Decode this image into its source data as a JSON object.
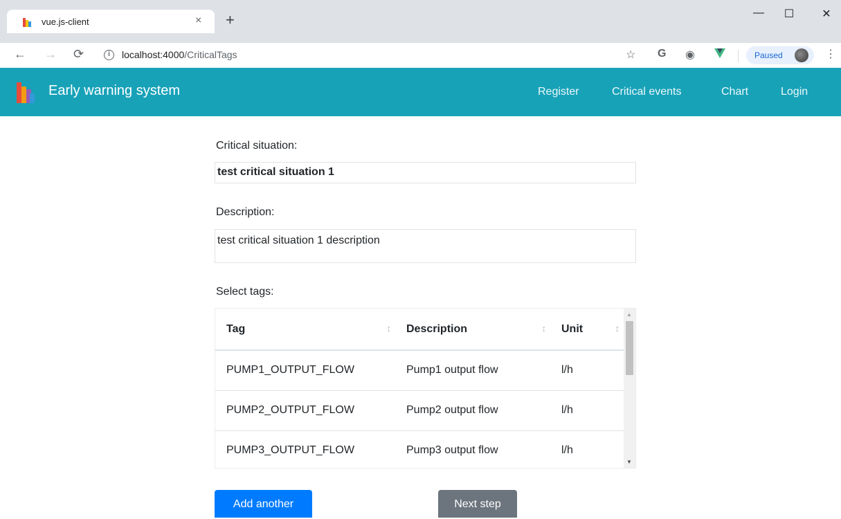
{
  "browser": {
    "tab_title": "vue.js-client",
    "tab_close": "×",
    "new_tab": "+",
    "url_host": "localhost:4000",
    "url_path": "/CriticalTags",
    "profile_label": "Paused",
    "window_minimize": "—",
    "window_maximize": "☐",
    "window_close": "✕"
  },
  "navbar": {
    "brand": "Early warning system",
    "links": [
      "Register",
      "Critical events",
      "Chart",
      "Login"
    ]
  },
  "form": {
    "critical_label": "Critical situation:",
    "critical_value": "test critical situation 1",
    "description_label": "Description:",
    "description_value": "test critical situation 1 description",
    "tags_label": "Select tags:"
  },
  "table": {
    "headers": [
      "Tag",
      "Description",
      "Unit"
    ],
    "rows": [
      [
        "PUMP1_OUTPUT_FLOW",
        "Pump1 output flow",
        "l/h"
      ],
      [
        "PUMP2_OUTPUT_FLOW",
        "Pump2 output flow",
        "l/h"
      ],
      [
        "PUMP3_OUTPUT_FLOW",
        "Pump3 output flow",
        "l/h"
      ]
    ]
  },
  "buttons": {
    "add_another": "Add another",
    "next_step": "Next step"
  },
  "colors": {
    "navbar": "#17a2b8",
    "primary": "#007bff",
    "secondary": "#6c757d"
  },
  "icons": [
    "back-arrow-icon",
    "forward-arrow-icon",
    "reload-icon",
    "info-icon",
    "star-icon",
    "google-icon",
    "extension-icon",
    "vue-devtools-icon",
    "menu-dots-icon"
  ]
}
